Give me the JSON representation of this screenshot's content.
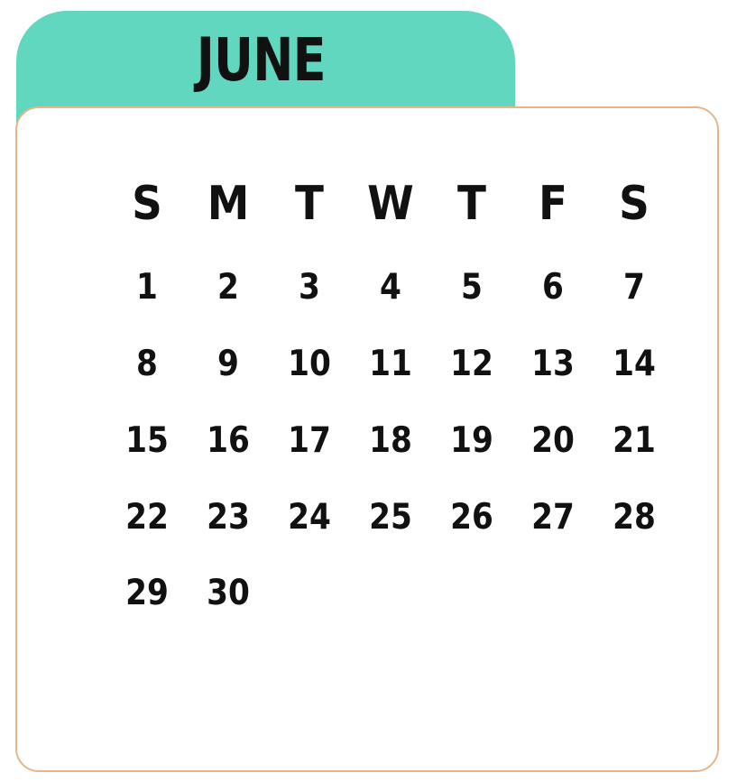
{
  "calendar": {
    "month": "JUNE",
    "weekdays": [
      "S",
      "M",
      "T",
      "W",
      "T",
      "F",
      "S"
    ],
    "weeks": [
      [
        "1",
        "2",
        "3",
        "4",
        "5",
        "6",
        "7"
      ],
      [
        "8",
        "9",
        "10",
        "11",
        "12",
        "13",
        "14"
      ],
      [
        "15",
        "16",
        "17",
        "18",
        "19",
        "20",
        "21"
      ],
      [
        "22",
        "23",
        "24",
        "25",
        "26",
        "27",
        "28"
      ],
      [
        "29",
        "30",
        "",
        "",
        "",
        "",
        ""
      ]
    ]
  },
  "colors": {
    "tab": "#62d7c0",
    "border": "#e7b58a",
    "text": "#111111",
    "background": "#ffffff"
  }
}
